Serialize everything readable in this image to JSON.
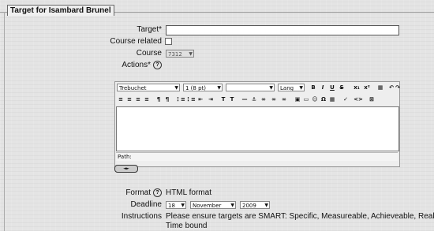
{
  "fieldset": {
    "legend": "Target for Isambard Brunel"
  },
  "form": {
    "target": {
      "label": "Target*",
      "value": ""
    },
    "course_related": {
      "label": "Course related",
      "checked": false
    },
    "course": {
      "label": "Course",
      "selected": "7312"
    },
    "actions": {
      "label": "Actions*",
      "help": "?"
    },
    "editor": {
      "font": "Trebuchet",
      "size": "1 (8 pt)",
      "style": "",
      "lang": "Lang",
      "toolbar1": [
        "B",
        "I",
        "U",
        "S",
        "x₁",
        "x²",
        "▦",
        "↶",
        "↷"
      ],
      "toolbar2": [
        "≡",
        "≡",
        "≡",
        "≡",
        "¶",
        "¶",
        "⋮≡",
        "⋮≡",
        "⇤",
        "⇥",
        "T",
        "T",
        "—",
        "⚓",
        "∞",
        "∞",
        "∞",
        "▣",
        "▭",
        "☺",
        "Ω",
        "▦",
        "✓",
        "<>",
        "⊠"
      ],
      "path_label": "Path:",
      "resize_label": "◄►"
    },
    "format": {
      "label": "Format",
      "value": "HTML format",
      "help": "?"
    },
    "deadline": {
      "label": "Deadline",
      "day": "18",
      "month": "November",
      "year": "2009"
    },
    "instructions": {
      "label": "Instructions",
      "line1": "Please ensure targets are SMART: Specific, Measureable, Achieveable, Realistic,",
      "line2": "Time bound"
    }
  }
}
